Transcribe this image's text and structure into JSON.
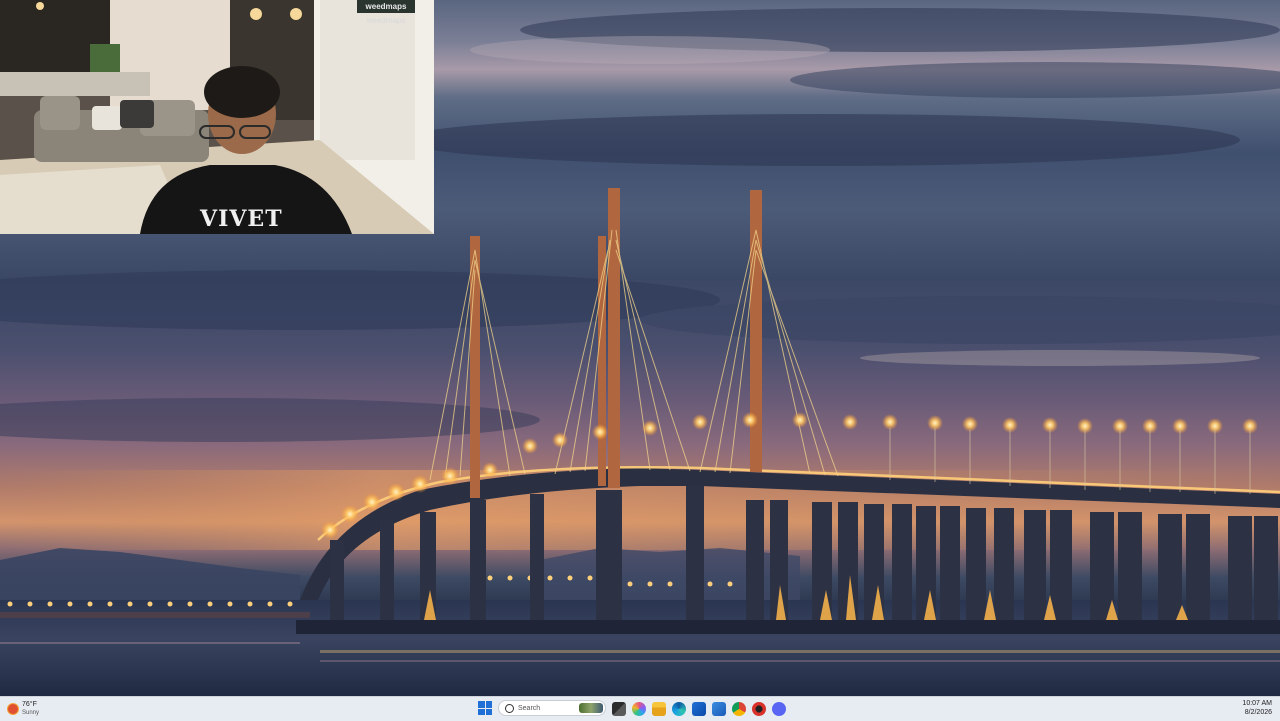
{
  "webcam": {
    "sign_top": "weedmaps",
    "sign_reflection": "weedmaps",
    "shirt_text": "VIVET"
  },
  "taskbar": {
    "weather": {
      "temperature": "76°F",
      "condition": "Sunny"
    },
    "search": {
      "placeholder": "Search"
    },
    "apps": [
      "task-view-icon",
      "copilot-icon",
      "file-explorer-icon",
      "edge-icon",
      "store-icon",
      "mail-icon",
      "chrome-icon",
      "app-red-icon",
      "discord-icon"
    ],
    "clock": {
      "time": "10:07 AM",
      "date": "8/2/2026"
    }
  },
  "colors": {
    "taskbar_bg": "#e7ebf2",
    "windows_blue": "#1f6fd6",
    "bridge_light": "#ffcf7a"
  }
}
